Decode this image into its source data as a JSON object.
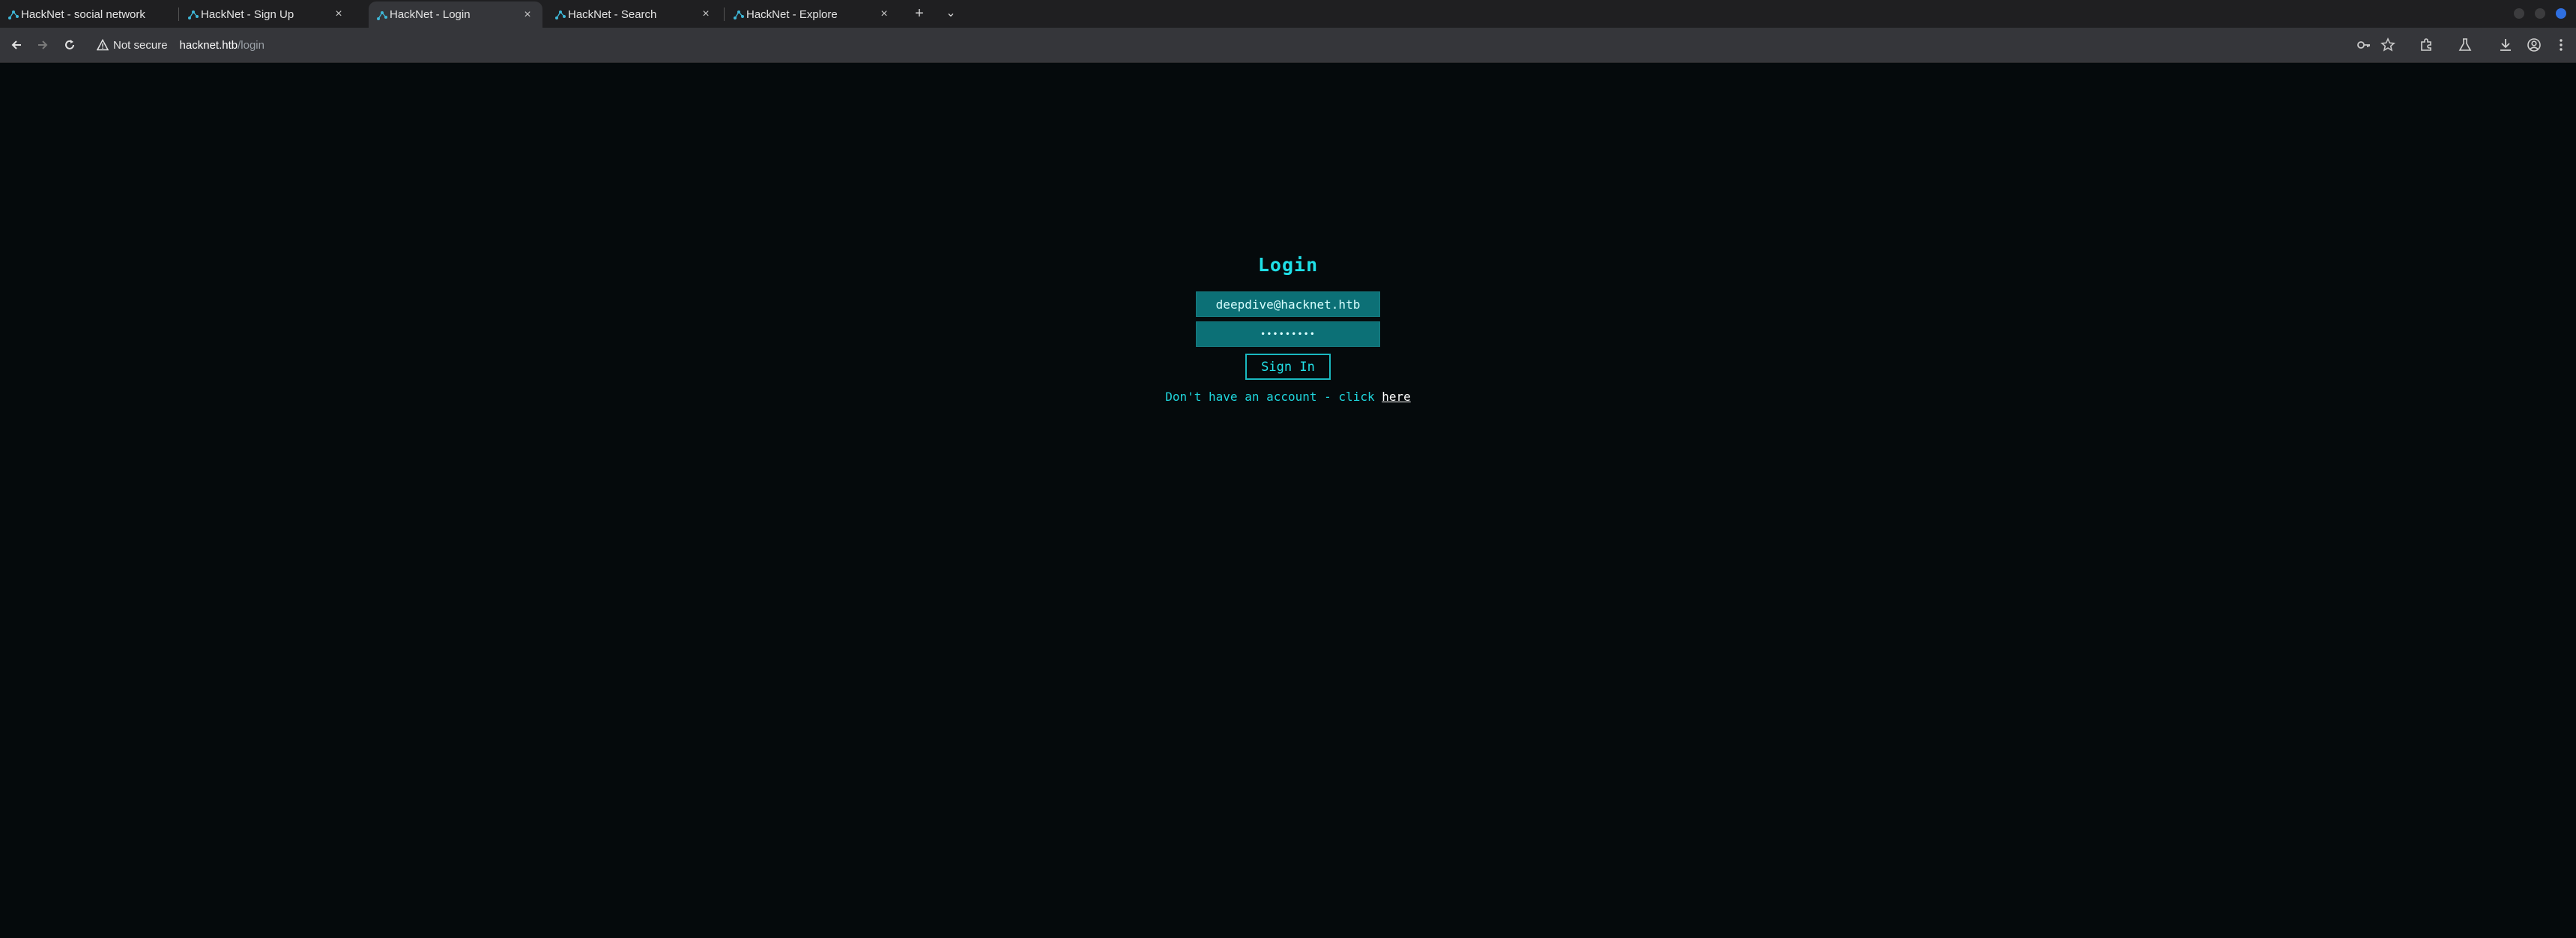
{
  "tabs": [
    {
      "title": "HackNet - social network",
      "active": false
    },
    {
      "title": "HackNet - Sign Up",
      "active": false
    },
    {
      "title": "HackNet - Login",
      "active": true
    },
    {
      "title": "HackNet - Search",
      "active": false
    },
    {
      "title": "HackNet - Explore",
      "active": false
    }
  ],
  "tabstrip": {
    "new_tab": "+",
    "tab_search": "⌄",
    "close_glyph": "×"
  },
  "toolbar": {
    "security_label": "Not secure",
    "url_host": "hacknet.htb",
    "url_path": "/login"
  },
  "page": {
    "title": "Login",
    "email_value": "deepdive@hacknet.htb",
    "password_value": "•••••••••",
    "signin_label": "Sign In",
    "signup_prefix": "Don't have an account - click ",
    "signup_link": "here"
  },
  "colors": {
    "accent": "#1fe0e8",
    "field_bg": "#0c7076",
    "page_bg": "#050a0c"
  },
  "icons": {
    "favicon": "hacknet-graph-icon",
    "back": "arrow-left-icon",
    "forward": "arrow-right-icon",
    "reload": "reload-icon",
    "warning": "warning-triangle-icon",
    "key": "key-icon",
    "star": "star-icon",
    "extensions": "puzzle-icon",
    "labs": "flask-icon",
    "download": "download-icon",
    "profile": "profile-icon",
    "menu": "kebab-menu-icon"
  }
}
